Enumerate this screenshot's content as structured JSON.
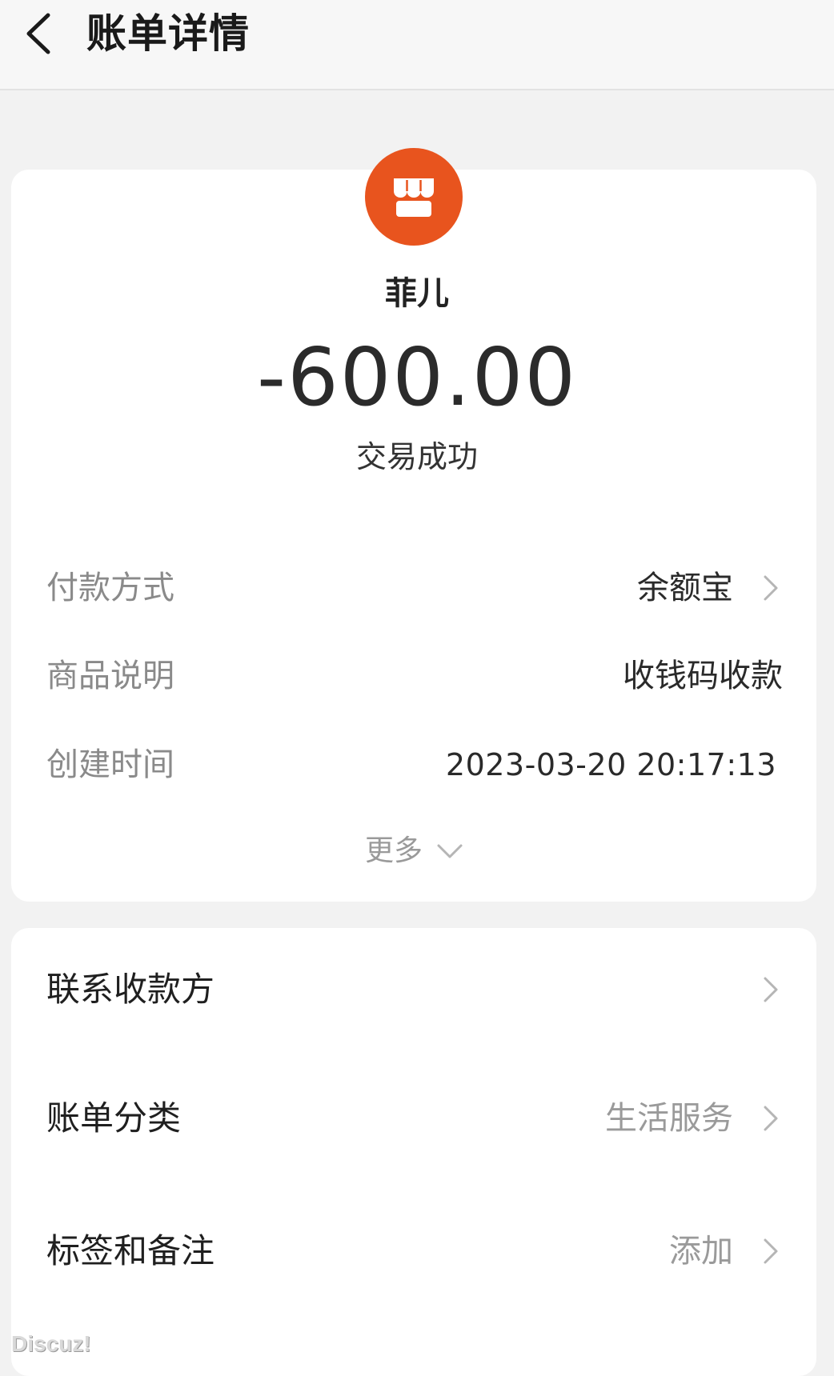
{
  "header": {
    "title": "账单详情",
    "back_icon": "chevron-left-icon"
  },
  "bill": {
    "merchant_icon": "storefront-icon",
    "merchant_color": "#e8541e",
    "merchant_name": "菲儿",
    "amount": "-600.00",
    "status": "交易成功"
  },
  "details": [
    {
      "label": "付款方式",
      "value": "余额宝",
      "has_chevron": true
    },
    {
      "label": "商品说明",
      "value": "收钱码收款",
      "has_chevron": false
    },
    {
      "label": "创建时间",
      "value": "2023-03-20 20:17:13",
      "has_chevron": false
    }
  ],
  "more": {
    "label": "更多",
    "icon": "chevron-down-icon"
  },
  "actions": [
    {
      "label": "联系收款方",
      "value": ""
    },
    {
      "label": "账单分类",
      "value": "生活服务"
    },
    {
      "label": "标签和备注",
      "value": "添加"
    }
  ],
  "watermark": "Discuz!"
}
